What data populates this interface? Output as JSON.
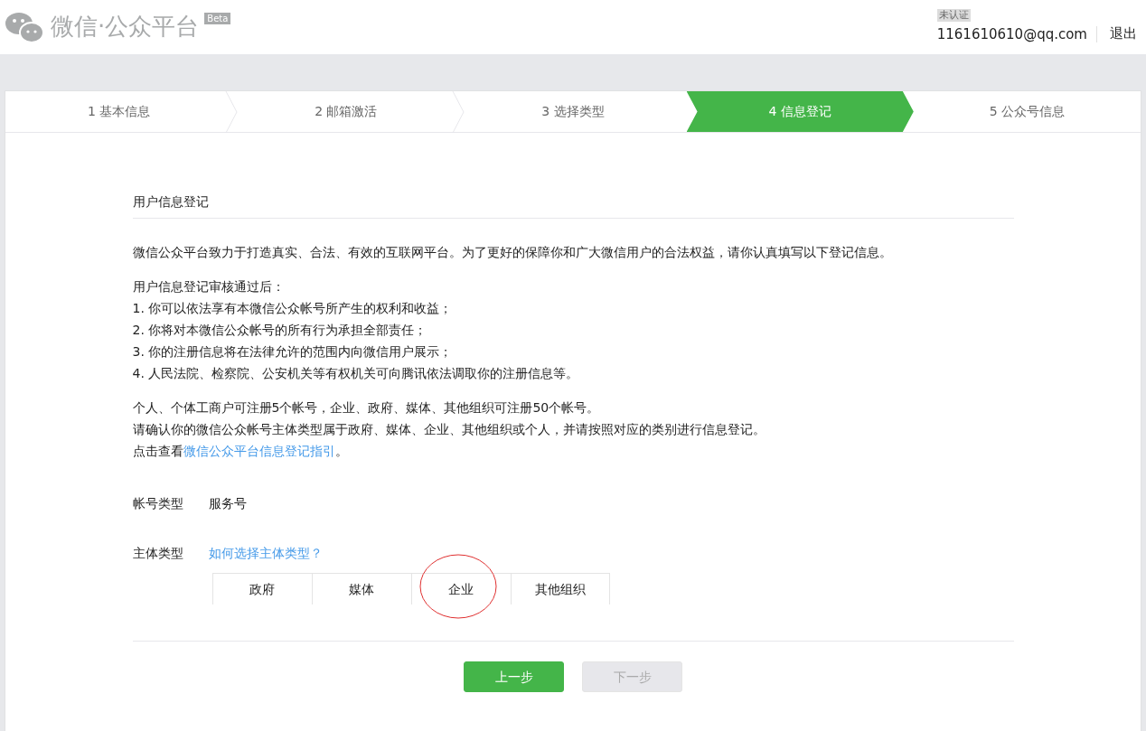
{
  "header": {
    "logo_text": "微信·公众平台",
    "badge": "Beta",
    "account_status": "未认证",
    "email": "1161610610@qq.com",
    "logout": "退出"
  },
  "steps": [
    {
      "label": "1 基本信息",
      "selected": false
    },
    {
      "label": "2 邮箱激活",
      "selected": false
    },
    {
      "label": "3 选择类型",
      "selected": false
    },
    {
      "label": "4 信息登记",
      "selected": true
    },
    {
      "label": "5 公众号信息",
      "selected": false
    }
  ],
  "section_title": "用户信息登记",
  "intro": "微信公众平台致力于打造真实、合法、有效的互联网平台。为了更好的保障你和广大微信用户的合法权益，请你认真填写以下登记信息。",
  "list_title": "用户信息登记审核通过后：",
  "list_items": [
    "1. 你可以依法享有本微信公众帐号所产生的权利和收益；",
    "2. 你将对本微信公众帐号的所有行为承担全部责任；",
    "3. 你的注册信息将在法律允许的范围内向微信用户展示；",
    "4. 人民法院、检察院、公安机关等有权机关可向腾讯依法调取你的注册信息等。"
  ],
  "notes": [
    "个人、个体工商户可注册5个帐号，企业、政府、媒体、其他组织可注册50个帐号。",
    "请确认你的微信公众帐号主体类型属于政府、媒体、企业、其他组织或个人，并请按照对应的类别进行信息登记。"
  ],
  "guide": {
    "prefix": "点击查看",
    "link": "微信公众平台信息登记指引",
    "suffix": "。"
  },
  "account_type": {
    "label": "帐号类型",
    "value": "服务号"
  },
  "subject_type": {
    "label": "主体类型",
    "help_link": "如何选择主体类型？",
    "options": [
      "政府",
      "媒体",
      "企业",
      "其他组织"
    ]
  },
  "buttons": [
    {
      "label": "上一步",
      "disabled": false
    },
    {
      "label": "下一步",
      "disabled": true
    }
  ]
}
